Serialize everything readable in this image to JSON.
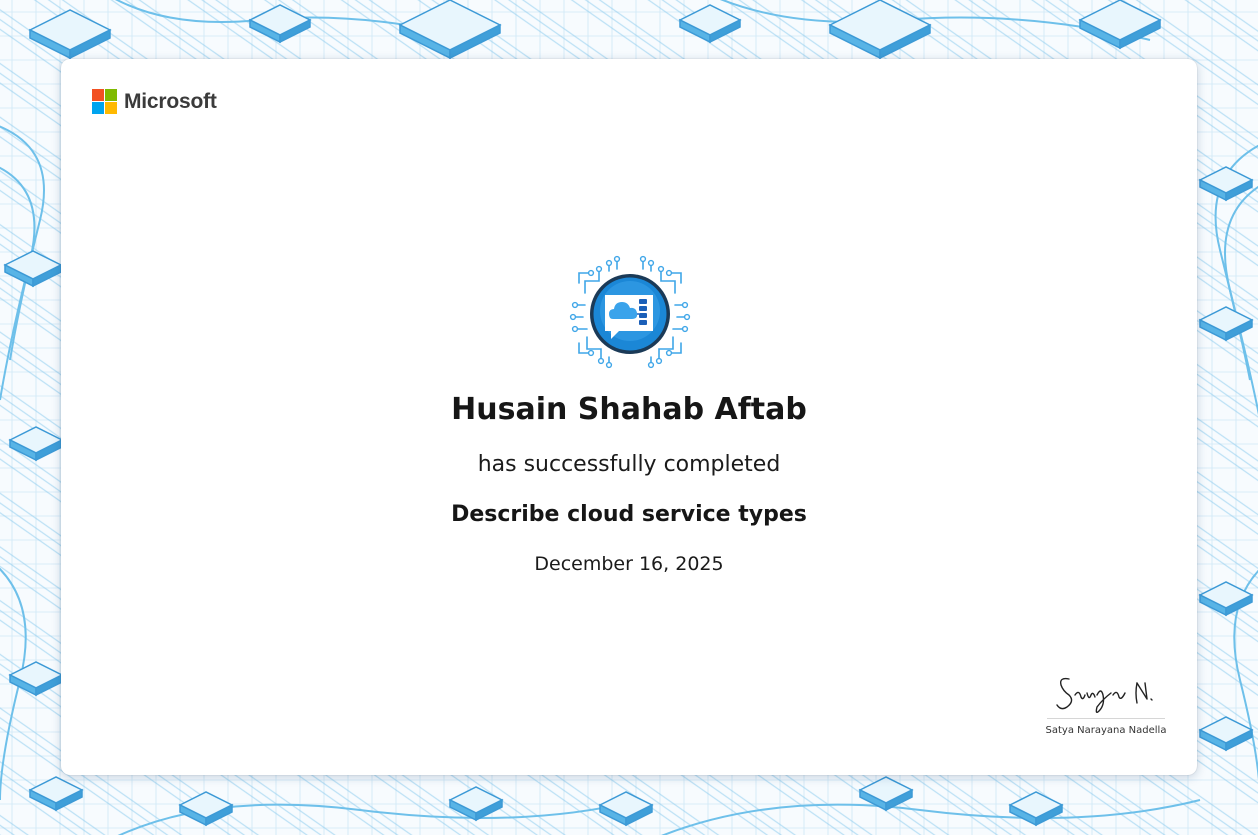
{
  "brand": {
    "name": "Microsoft",
    "logo_colors": [
      "#f25022",
      "#7fba00",
      "#00a4ef",
      "#ffb900"
    ]
  },
  "badge": {
    "icon": "cloud-services-badge-icon",
    "colors": {
      "ring": "#1b3a57",
      "fill": "#1b87d6",
      "circuit": "#3fa6e8"
    }
  },
  "certificate": {
    "recipient": "Husain Shahab Aftab",
    "statement": "has successfully completed",
    "course": "Describe cloud service types",
    "date": "December 16, 2025"
  },
  "signer": {
    "name": "Satya Narayana Nadella"
  },
  "colors": {
    "pattern": "#5cb8e6",
    "pattern_dark": "#2f86c8"
  }
}
